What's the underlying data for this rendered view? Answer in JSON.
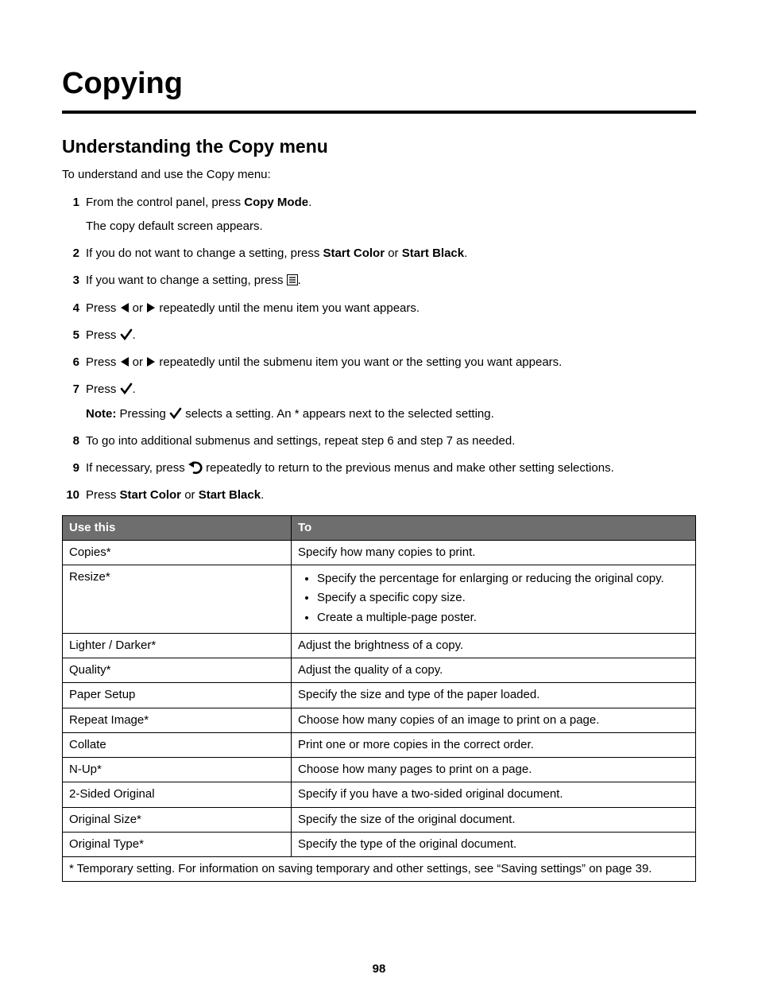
{
  "chapterTitle": "Copying",
  "sectionTitle": "Understanding the Copy menu",
  "intro": "To understand and use the Copy menu:",
  "steps": {
    "s1a": "From the control panel, press ",
    "s1b": "Copy Mode",
    "s1c": ".",
    "s1sub": "The copy default screen appears.",
    "s2a": "If you do not want to change a setting, press ",
    "s2b": "Start Color",
    "s2c": " or ",
    "s2d": "Start Black",
    "s2e": ".",
    "s3a": "If you want to change a setting, press ",
    "s3b": ".",
    "s4a": "Press ",
    "s4b": " or ",
    "s4c": " repeatedly until the menu item you want appears.",
    "s5a": "Press ",
    "s5b": ".",
    "s6a": "Press ",
    "s6b": " or ",
    "s6c": " repeatedly until the submenu item you want or the setting you want appears.",
    "s7a": "Press ",
    "s7b": ".",
    "noteLabel": "Note:",
    "noteA": " Pressing ",
    "noteB": " selects a setting. An * appears next to the selected setting.",
    "s8": "To go into additional submenus and settings, repeat step 6 and step 7 as needed.",
    "s9a": "If necessary, press ",
    "s9b": " repeatedly to return to the previous menus and make other setting selections.",
    "s10a": "Press ",
    "s10b": "Start Color",
    "s10c": " or ",
    "s10d": "Start Black",
    "s10e": "."
  },
  "table": {
    "header": {
      "useThis": "Use this",
      "to": "To"
    },
    "rows": [
      {
        "use": "Copies*",
        "to": "Specify how many copies to print."
      },
      {
        "use": "Resize*",
        "to_list": [
          "Specify the percentage for enlarging or reducing the original copy.",
          "Specify a specific copy size.",
          "Create a multiple-page poster."
        ]
      },
      {
        "use": "Lighter / Darker*",
        "to": "Adjust the brightness of a copy."
      },
      {
        "use": "Quality*",
        "to": "Adjust the quality of a copy."
      },
      {
        "use": "Paper Setup",
        "to": "Specify the size and type of the paper loaded."
      },
      {
        "use": "Repeat Image*",
        "to": "Choose how many copies of an image to print on a page."
      },
      {
        "use": "Collate",
        "to": "Print one or more copies in the correct order."
      },
      {
        "use": "N-Up*",
        "to": "Choose how many pages to print on a page."
      },
      {
        "use": "2-Sided Original",
        "to": "Specify if you have a two-sided original document."
      },
      {
        "use": "Original Size*",
        "to": "Specify the size of the original document."
      },
      {
        "use": "Original Type*",
        "to": "Specify the type of the original document."
      }
    ],
    "footnote": "* Temporary setting. For information on saving temporary and other settings, see “Saving settings” on page 39."
  },
  "pageNumber": "98"
}
